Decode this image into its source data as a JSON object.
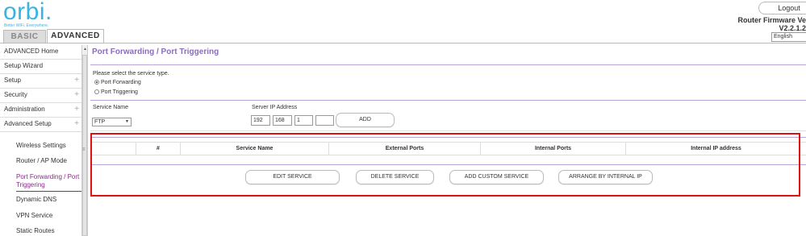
{
  "header": {
    "logo_text": "orbi.",
    "logo_tagline": "Better WiFi. Everywhere.",
    "logout_label": "Logout",
    "firmware_label": "Router Firmware Version",
    "firmware_version": "V2.2.1.2",
    "language_selected": "English",
    "tabs": [
      {
        "label": "BASIC"
      },
      {
        "label": "ADVANCED"
      }
    ]
  },
  "sidebar": {
    "items": [
      {
        "label": "ADVANCED Home"
      },
      {
        "label": "Setup Wizard"
      },
      {
        "label": "Setup",
        "expand": "+"
      },
      {
        "label": "Security",
        "expand": "+"
      },
      {
        "label": "Administration",
        "expand": "+"
      },
      {
        "label": "Advanced Setup",
        "expand": "+"
      }
    ],
    "subitems": [
      {
        "label": "Wireless Settings"
      },
      {
        "label": "Router / AP Mode"
      },
      {
        "label": "Port Forwarding / Port Triggering"
      },
      {
        "label": "Dynamic DNS"
      },
      {
        "label": "VPN Service"
      },
      {
        "label": "Static Routes"
      }
    ]
  },
  "main": {
    "title": "Port Forwarding / Port Triggering",
    "service_type_prompt": "Please select the service type.",
    "radio_options": [
      {
        "label": "Port Forwarding",
        "checked": true
      },
      {
        "label": "Port Triggering",
        "checked": false
      }
    ],
    "service_name_label": "Service Name",
    "service_name_value": "FTP",
    "server_ip_label": "Server IP Address",
    "ip_octets": [
      "192",
      "168",
      "1",
      ""
    ],
    "add_label": "ADD",
    "table_headers": [
      "",
      "#",
      "Service Name",
      "External Ports",
      "Internal Ports",
      "Internal IP address"
    ],
    "buttons": {
      "edit": "EDIT SERVICE",
      "delete": "DELETE SERVICE",
      "add_custom": "ADD CUSTOM SERVICE",
      "arrange": "ARRANGE BY INTERNAL IP"
    }
  },
  "colors": {
    "brand_blue": "#3bb2e0",
    "title_purple": "#8a6bc0",
    "active_nav": "#8a2b8c",
    "highlight_red": "#e01010"
  }
}
